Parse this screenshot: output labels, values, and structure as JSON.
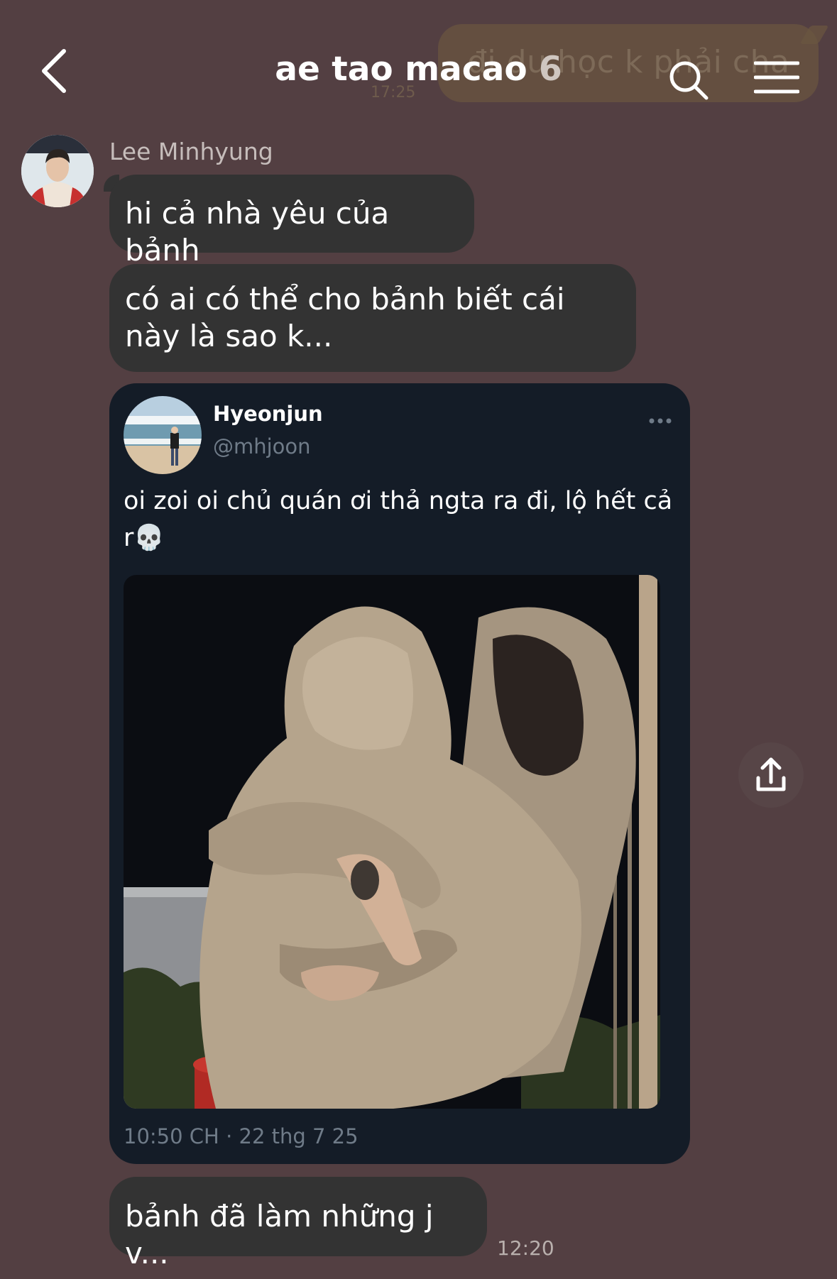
{
  "header": {
    "title": "ae tao macao",
    "member_count": "6",
    "back_icon": "chevron-left-icon",
    "search_icon": "search-icon",
    "menu_icon": "menu-icon"
  },
  "background_message": {
    "text": "đi du học k phải cha",
    "time": "17:25"
  },
  "chat": {
    "sender_name": "Lee Minhyung",
    "messages": [
      {
        "text": "hi cả nhà yêu của bảnh"
      },
      {
        "text": "có ai có thể cho bảnh biết cái này là sao k..."
      },
      {
        "text": "bảnh đã làm những j v...",
        "time": "12:20"
      }
    ]
  },
  "shared_post": {
    "author_name": "Hyeonjun",
    "author_handle": "@mhjoon",
    "text": "oi zoi oi chủ quán ơi thả ngta ra đi, lộ hết cả r💀",
    "timestamp": "10:50 CH · 22 thg 7 25",
    "more_icon": "more-dots-icon"
  },
  "actions": {
    "share_icon": "share-icon"
  },
  "colors": {
    "background": "#533f42",
    "bubble": "#333333",
    "card": "#141c27",
    "secondary_text": "#6f7b88"
  }
}
